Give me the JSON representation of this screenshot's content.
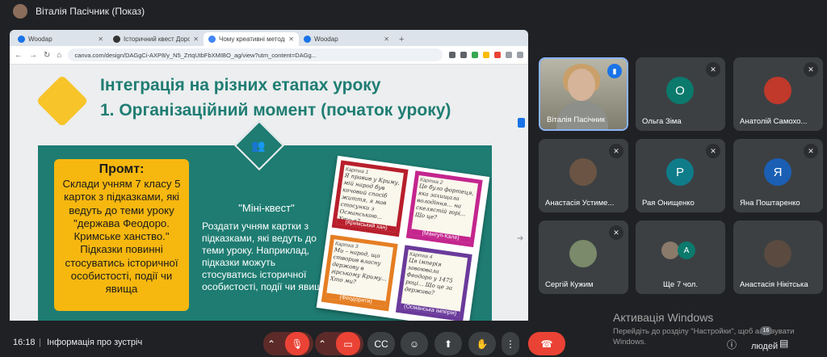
{
  "presenter_bar": {
    "title": "Віталія Пасічник (Показ)"
  },
  "browser": {
    "tabs": [
      {
        "label": "Woodap",
        "active": false
      },
      {
        "label": "Історичний квест Дорошенка",
        "active": false
      },
      {
        "label": "Чому креативні методи навчання",
        "active": true
      },
      {
        "label": "Woodap",
        "active": false
      }
    ],
    "url": "canva.com/design/DAGgCi-AXP8/y_N5_ZrtqUtbFbXMIBO_ag/view?utm_content=DAGg..."
  },
  "slide": {
    "title_line1": "Інтеграція на різних етапах уроку",
    "title_line2": "1. Організаційний момент (початок уроку)",
    "prompt_heading": "Промт:",
    "prompt_body": "Склади учням 7 класу 5 карток з підказками, які ведуть до теми уроку \"держава Феодоро. Кримське ханство.\" Підказки повинні стосуватись історичної особистості, події чи явища",
    "mini_heading": "\"Міні-квест\"",
    "mini_body": "Роздати учням картки з підказками, які ведуть до теми уроку. Наприклад, підказки можуть стосуватись історичної особистості, події чи явища",
    "cards": [
      {
        "title": "Картка 1",
        "text": "Я правив у Криму, мій народ був кочовий спосіб життя, я мав стосунки з Османською... Хто я?",
        "caption": "(Кримський хан)"
      },
      {
        "title": "Картка 2",
        "text": "Це було фортеця, яка захищала володіння... на скелястій горі... Що це?",
        "caption": "(Мангуп-Кале)"
      },
      {
        "title": "Картка 3",
        "text": "Ми – народ, що створив власну державу в гірському Криму... Хто ми?",
        "caption": "(Феодорити)"
      },
      {
        "title": "Картка 4",
        "text": "Ця імперія завоювала Феодоро у 1475 році... Що це за держава?",
        "caption": "(Османська імперія)"
      }
    ]
  },
  "participants": [
    {
      "name": "Віталія Пасічник",
      "type": "presenter"
    },
    {
      "name": "Ольга Зіма",
      "type": "letter",
      "letter": "О",
      "color": "#0b7a6d"
    },
    {
      "name": "Анатолій Самохо...",
      "type": "photo",
      "color": "#c0392b"
    },
    {
      "name": "Анастасія Устиме...",
      "type": "photo",
      "color": "#6b5444"
    },
    {
      "name": "Рая Онищенко",
      "type": "letter",
      "letter": "Р",
      "color": "#0f7c8a"
    },
    {
      "name": "Яна Поштаренко",
      "type": "letter",
      "letter": "Я",
      "color": "#1a5fb4"
    },
    {
      "name": "Сергій Кужим",
      "type": "photo",
      "color": "#7a8a6a"
    },
    {
      "name": "Ще 7 чол.",
      "type": "more",
      "letter": "А"
    },
    {
      "name": "Анастасія Нікітська",
      "type": "photo",
      "color": "#5a4a40"
    }
  ],
  "watermark": {
    "title": "Активація Windows",
    "subtitle": "Перейдіть до розділу \"Настройки\", щоб активувати Windows."
  },
  "bottom": {
    "time": "16:18",
    "separator": "|",
    "meeting_info": "Інформація про зустріч",
    "people_label": "людей",
    "people_count": "16"
  },
  "colors": {
    "background": "#202124",
    "accent": "#8ab4f8",
    "danger": "#ea4335",
    "teal": "#1e7c72",
    "yellow": "#f6b70f"
  }
}
